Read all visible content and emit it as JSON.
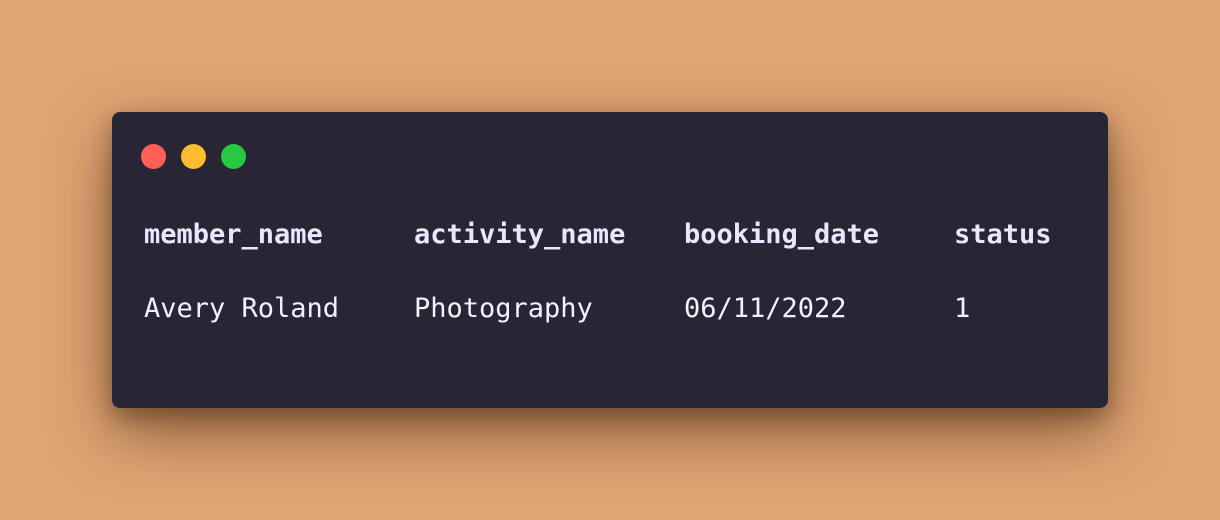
{
  "window": {
    "controls": [
      {
        "name": "close-icon",
        "color": "#ff5f57"
      },
      {
        "name": "minimize-icon",
        "color": "#febc2e"
      },
      {
        "name": "maximize-icon",
        "color": "#28c840"
      }
    ]
  },
  "table": {
    "headers": [
      "member_name",
      "activity_name",
      "booking_date",
      "status"
    ],
    "rows": [
      [
        "Avery Roland",
        "Photography",
        "06/11/2022",
        "1"
      ]
    ]
  },
  "colors": {
    "background": "#dfa574",
    "window": "#282634",
    "text": "#f3f0ff"
  }
}
